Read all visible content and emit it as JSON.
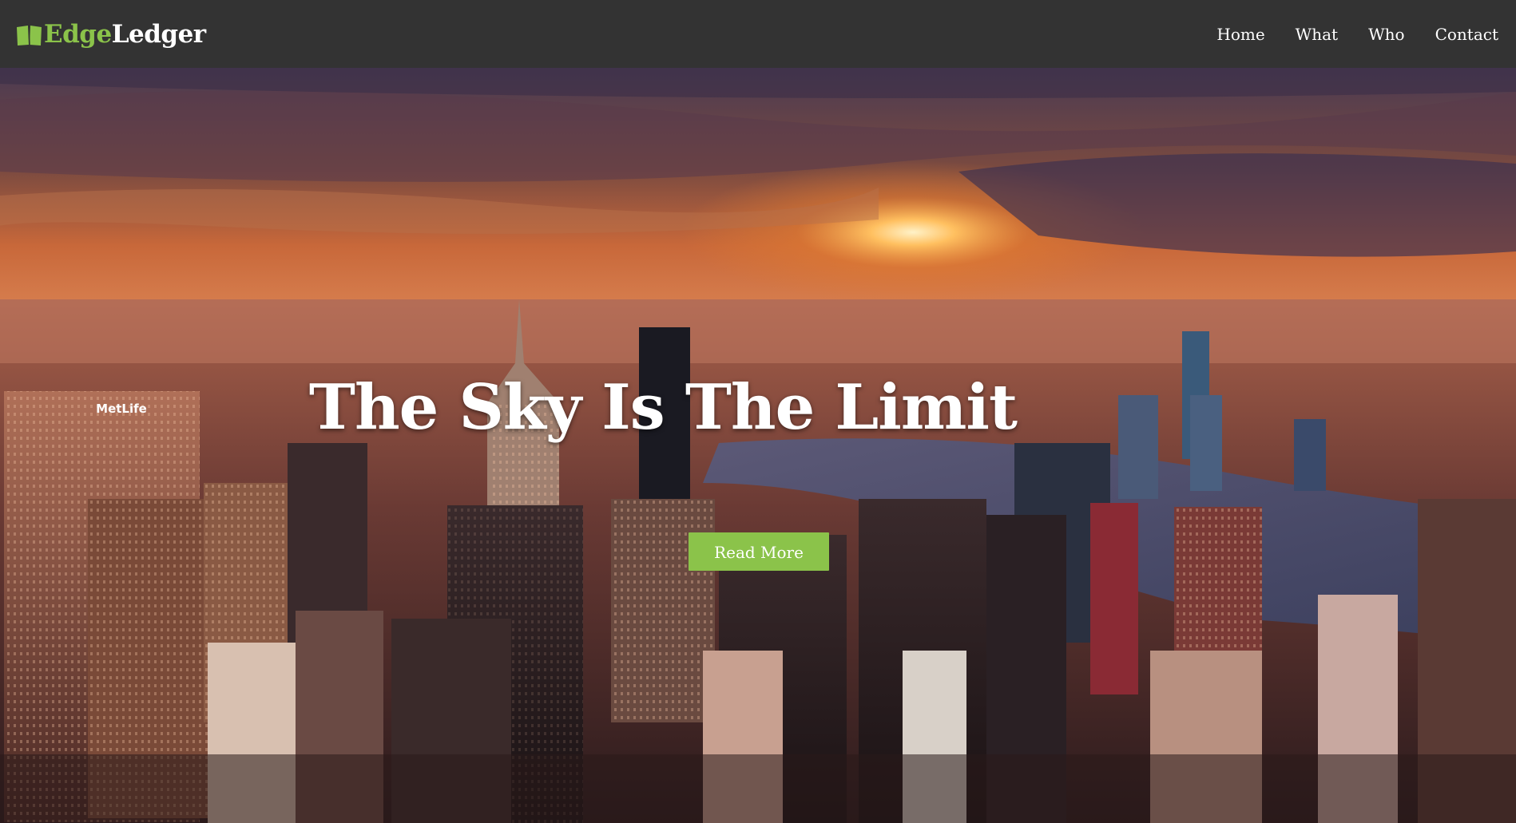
{
  "brand": {
    "prefix": "Edge",
    "suffix": "Ledger",
    "icon": "open-book-icon",
    "accent_color": "#8bc34a"
  },
  "nav": {
    "items": [
      {
        "label": "Home"
      },
      {
        "label": "What"
      },
      {
        "label": "Who"
      },
      {
        "label": "Contact"
      }
    ]
  },
  "hero": {
    "title": "The Sky Is The Limit",
    "button_label": "Read More",
    "background": "city-skyline-sunset-photo",
    "building_sign": "MetLife"
  },
  "colors": {
    "navbar": "#333333",
    "button": "#8bc34a",
    "text": "#ffffff"
  }
}
